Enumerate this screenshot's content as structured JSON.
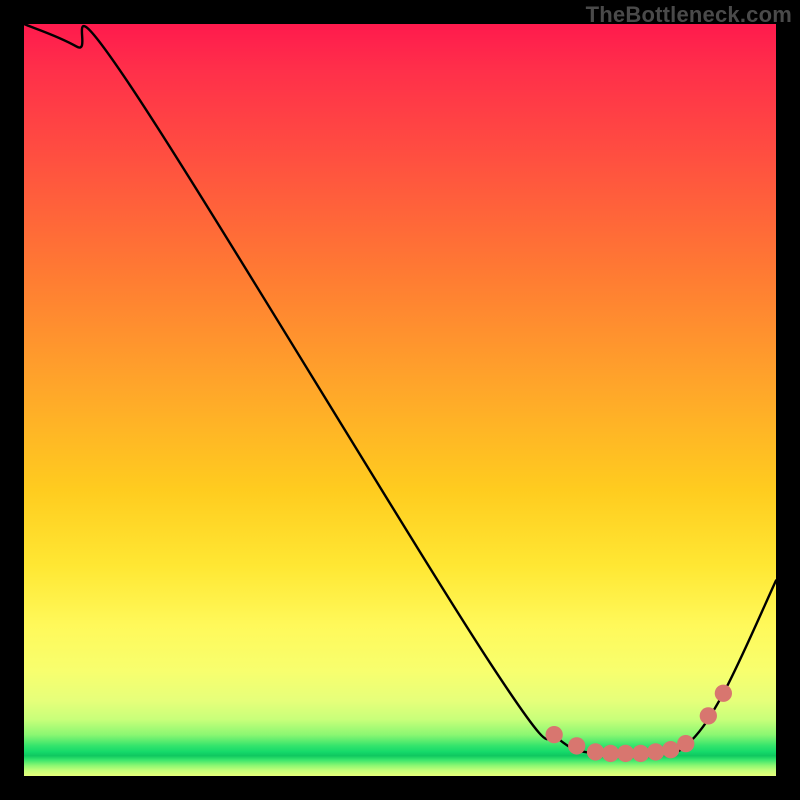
{
  "watermark": "TheBottleneck.com",
  "chart_data": {
    "type": "line",
    "title": "",
    "xlabel": "",
    "ylabel": "",
    "xlim": [
      0,
      100
    ],
    "ylim": [
      0,
      100
    ],
    "curve": {
      "name": "bottleneck-curve",
      "x": [
        0,
        7,
        14,
        62,
        71,
        76,
        80,
        84,
        88,
        93,
        100
      ],
      "y": [
        100,
        97,
        92,
        15,
        5,
        3,
        3,
        3,
        4,
        11,
        26
      ]
    },
    "markers": {
      "name": "highlight-points",
      "color": "#d8766f",
      "x": [
        70.5,
        73.5,
        76,
        78,
        80,
        82,
        84,
        86,
        88,
        91,
        93
      ],
      "y": [
        5.5,
        4.0,
        3.2,
        3.0,
        3.0,
        3.0,
        3.2,
        3.5,
        4.3,
        8,
        11
      ]
    },
    "gradient_stops": [
      {
        "pos": 0.0,
        "color": "#ff1a4d"
      },
      {
        "pos": 0.33,
        "color": "#ff7a33"
      },
      {
        "pos": 0.62,
        "color": "#ffcc1f"
      },
      {
        "pos": 0.86,
        "color": "#f8ff6e"
      },
      {
        "pos": 0.965,
        "color": "#15d96a"
      },
      {
        "pos": 1.0,
        "color": "#e6ff7a"
      }
    ]
  }
}
